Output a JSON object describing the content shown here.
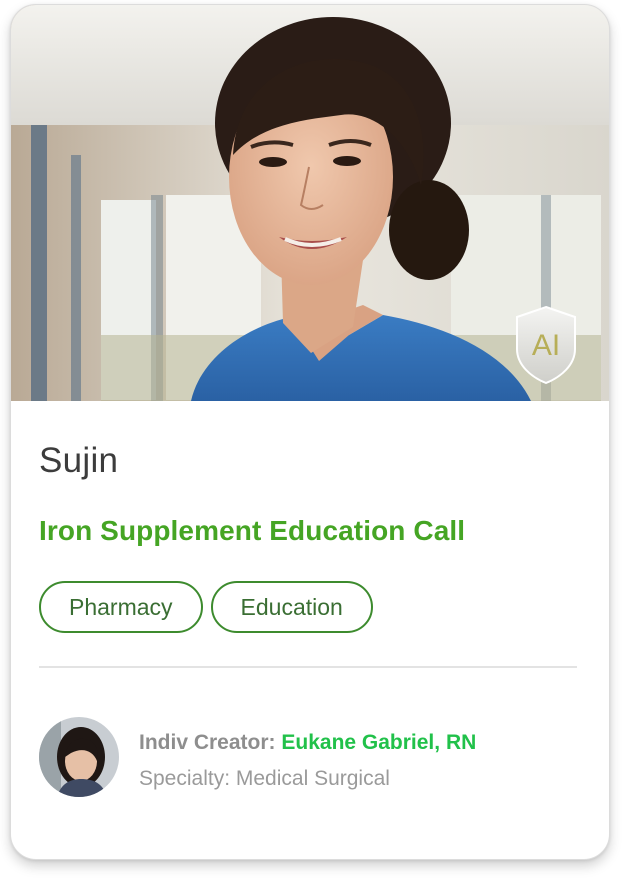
{
  "card": {
    "name": "Sujin",
    "title": "Iron Supplement Education Call",
    "ai_badge_label": "AI",
    "tags": [
      {
        "label": "Pharmacy"
      },
      {
        "label": "Education"
      }
    ],
    "creator": {
      "label": "Indiv Creator:",
      "name": "Eukane Gabriel, RN"
    },
    "specialty": "Specialty: Medical Surgical"
  },
  "colors": {
    "accent_green": "#45a524",
    "creator_green": "#21c14a",
    "tag_border": "#3d8b2e"
  }
}
